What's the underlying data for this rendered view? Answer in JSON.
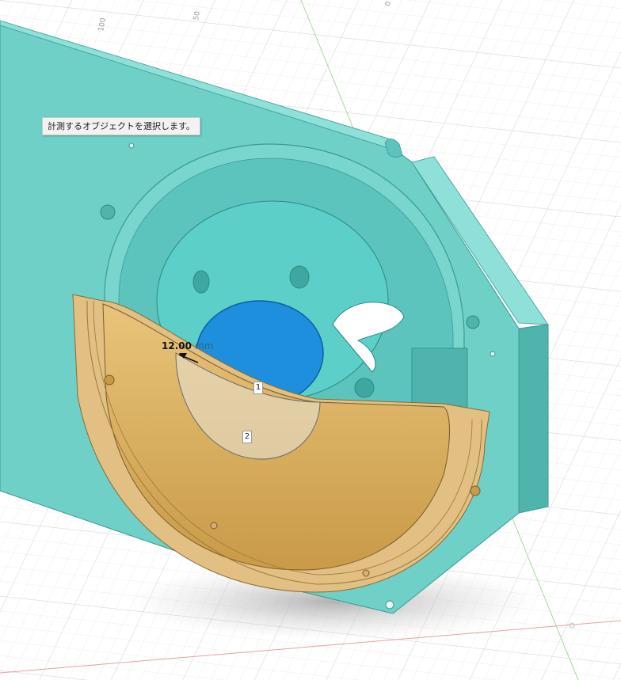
{
  "tooltip": {
    "text": "計測するオブジェクトを選択します。"
  },
  "measurement": {
    "value": "12.00",
    "unit": "mm"
  },
  "markers": {
    "first": "1",
    "second": "2"
  },
  "ruler": {
    "labels": [
      "100",
      "50",
      "0"
    ]
  },
  "colors": {
    "plate": "#6fd0c8",
    "plate_edge": "#4bb0a8",
    "hub": "#5ccfc8",
    "selected_face": "#1e8fdc",
    "cover": "#dcb060",
    "grid_minor": "#eeeeee",
    "grid_major": "#dcdcdc",
    "axis_green": "#a8d8a0",
    "axis_red": "#e8a0a0"
  }
}
